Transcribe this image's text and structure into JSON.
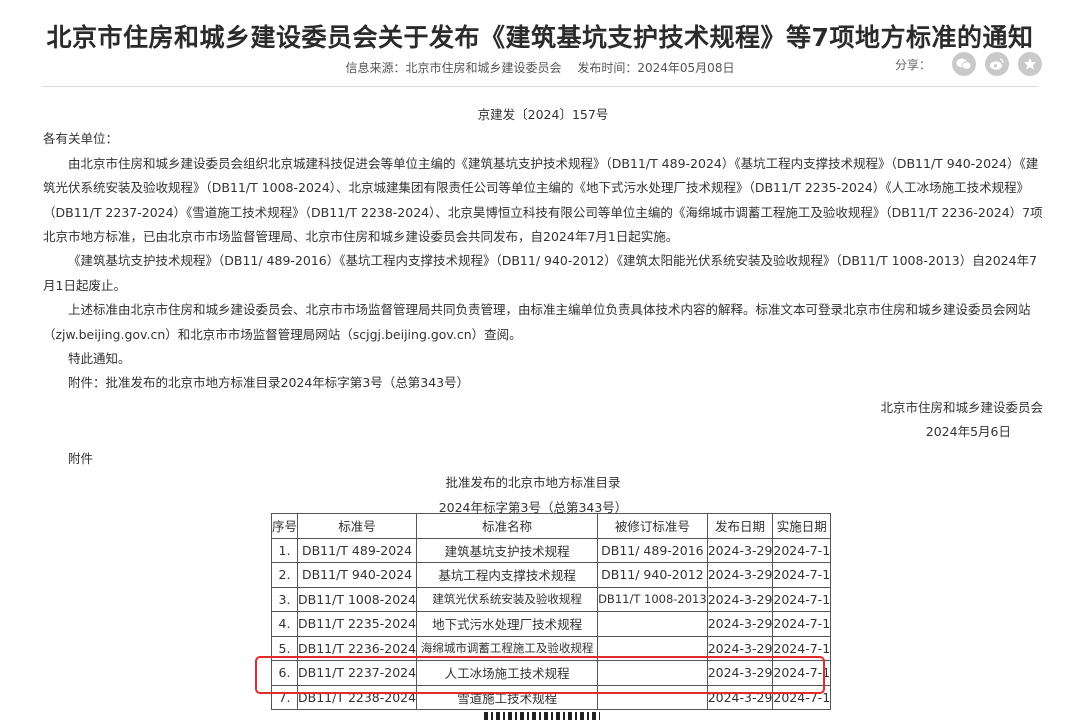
{
  "page": {
    "title": "北京市住房和城乡建设委员会关于发布《建筑基坑支护技术规程》等7项地方标准的通知",
    "source_label": "信息来源：北京市住房和城乡建设委员会",
    "date_label": "发布时间：2024年05月08日",
    "share_label": "分享：",
    "share_icons": [
      "wechat-icon",
      "weibo-icon",
      "favorite-icon"
    ]
  },
  "doc": {
    "doc_number": "京建发〔2024〕157号",
    "salutation": "各有关单位：",
    "paragraphs": [
      "由北京市住房和城乡建设委员会组织北京城建科技促进会等单位主编的《建筑基坑支护技术规程》（DB11/T 489-2024）《基坑工程内支撑技术规程》（DB11/T 940-2024）《建筑光伏系统安装及验收规程》（DB11/T 1008-2024）、北京城建集团有限责任公司等单位主编的《地下式污水处理厂技术规程》（DB11/T 2235-2024）《人工冰场施工技术规程》（DB11/T 2237-2024）《雪道施工技术规程》（DB11/T 2238-2024）、北京昊博恒立科技有限公司等单位主编的《海绵城市调蓄工程施工及验收规程》（DB11/T 2236-2024）7项北京市地方标准，已由北京市市场监督管理局、北京市住房和城乡建设委员会共同发布，自2024年7月1日起实施。",
      "《建筑基坑支护技术规程》（DB11/ 489-2016）《基坑工程内支撑技术规程》（DB11/ 940-2012）《建筑太阳能光伏系统安装及验收规程》（DB11/T 1008-2013）自2024年7月1日起废止。",
      "上述标准由北京市住房和城乡建设委员会、北京市市场监督管理局共同负责管理，由标准主编单位负责具体技术内容的解释。标准文本可登录北京市住房和城乡建设委员会网站（zjw.beijing.gov.cn）和北京市市场监督管理局网站（scjgj.beijing.gov.cn）查阅。",
      "特此通知。",
      "附件：批准发布的北京市地方标准目录2024年标字第3号（总第343号）"
    ],
    "signature": "北京市住房和城乡建设委员会",
    "sign_date": "2024年5月6日",
    "attachment_label": "附件",
    "table_title": "批准发布的北京市地方标准目录",
    "table_subtitle": "2024年标字第3号（总第343号）"
  },
  "table": {
    "headers": [
      "序号",
      "标准号",
      "标准名称",
      "被修订标准号",
      "发布日期",
      "实施日期"
    ],
    "rows": [
      [
        "1.",
        "DB11/T 489-2024",
        "建筑基坑支护技术规程",
        "DB11/ 489-2016",
        "2024-3-29",
        "2024-7-1"
      ],
      [
        "2.",
        "DB11/T 940-2024",
        "基坑工程内支撑技术规程",
        "DB11/ 940-2012",
        "2024-3-29",
        "2024-7-1"
      ],
      [
        "3.",
        "DB11/T 1008-2024",
        "建筑光伏系统安装及验收规程",
        "DB11/T 1008-2013",
        "2024-3-29",
        "2024-7-1"
      ],
      [
        "4.",
        "DB11/T 2235-2024",
        "地下式污水处理厂技术规程",
        "",
        "2024-3-29",
        "2024-7-1"
      ],
      [
        "5.",
        "DB11/T 2236-2024",
        "海绵城市调蓄工程施工及验收规程",
        "",
        "2024-3-29",
        "2024-7-1"
      ],
      [
        "6.",
        "DB11/T 2237-2024",
        "人工冰场施工技术规程",
        "",
        "2024-3-29",
        "2024-7-1"
      ],
      [
        "7.",
        "DB11/T 2238-2024",
        "雪道施工技术规程",
        "",
        "2024-3-29",
        "2024-7-1"
      ]
    ],
    "highlighted_row": 6,
    "highlight_color": "#e22b2b"
  }
}
